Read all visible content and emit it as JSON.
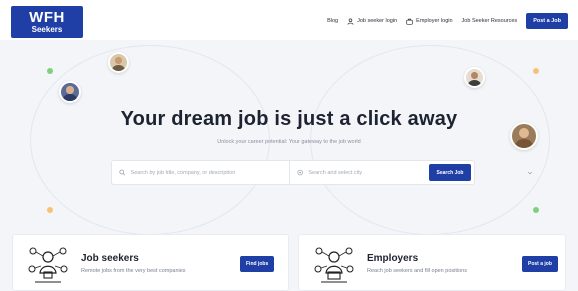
{
  "colors": {
    "brand": "#1f3fa6",
    "background": "#f3f5f9",
    "dot_green": "#7ed07a",
    "dot_orange": "#f6c27a"
  },
  "logo": {
    "line1": "WFH",
    "line2": "Seekers"
  },
  "nav": {
    "blog": "Blog",
    "job_seeker_login": "Job seeker login",
    "employer_login": "Employer login",
    "resources": "Job Seeker Resources",
    "post_job": "Post a Job"
  },
  "hero": {
    "title": "Your dream job is just a click away",
    "subtitle": "Unlock your career potential: Your gateway to the job world"
  },
  "search": {
    "keyword_placeholder": "Search by job title, company, or description",
    "location_placeholder": "Search and select city",
    "button": "Search Job"
  },
  "cards": [
    {
      "title": "Job seekers",
      "desc": "Remote jobs from the very best companies",
      "button": "Find jobs",
      "icon": "job-seeker-illustration"
    },
    {
      "title": "Employers",
      "desc": "Reach job seekers and fill open positions",
      "button": "Post a job",
      "icon": "employer-illustration"
    }
  ]
}
